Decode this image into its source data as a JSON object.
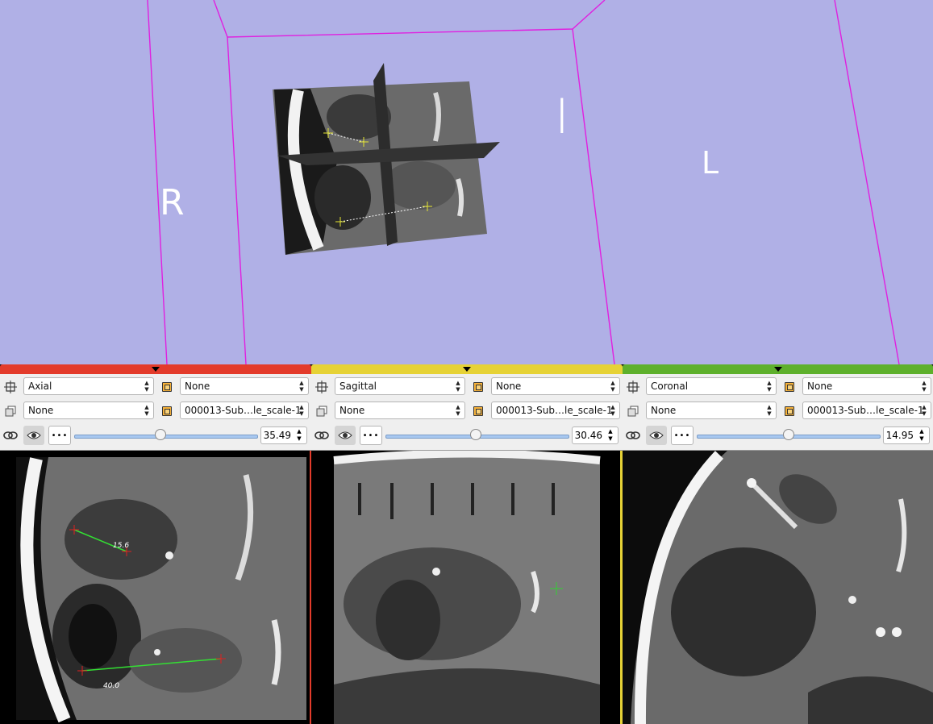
{
  "view3d": {
    "bg": "#b0b0e6",
    "labels": {
      "right": "R",
      "inferior": "I",
      "left": "L"
    }
  },
  "panels": [
    {
      "id": "red",
      "color": "#e33b2b",
      "orientation": "Axial",
      "foreground": "None",
      "background": "None",
      "label_volume": "000013-Sub…le_scale-1",
      "offset": "35.49",
      "slider_pct": 0.47,
      "measurements": [
        "15.6",
        "40.0"
      ]
    },
    {
      "id": "yellow",
      "color": "#e6d236",
      "orientation": "Sagittal",
      "foreground": "None",
      "background": "None",
      "label_volume": "000013-Sub…le_scale-1",
      "offset": "30.46",
      "slider_pct": 0.49
    },
    {
      "id": "green",
      "color": "#5eb02c",
      "orientation": "Coronal",
      "foreground": "None",
      "background": "None",
      "label_volume": "000013-Sub…le_scale-1",
      "offset": "14.95",
      "slider_pct": 0.5
    }
  ],
  "icons": {
    "pin": "pin-icon",
    "layers": "layers-icon",
    "link": "link-icon",
    "eye": "eye-icon",
    "more": "more-icon",
    "volume": "volume-icon"
  }
}
